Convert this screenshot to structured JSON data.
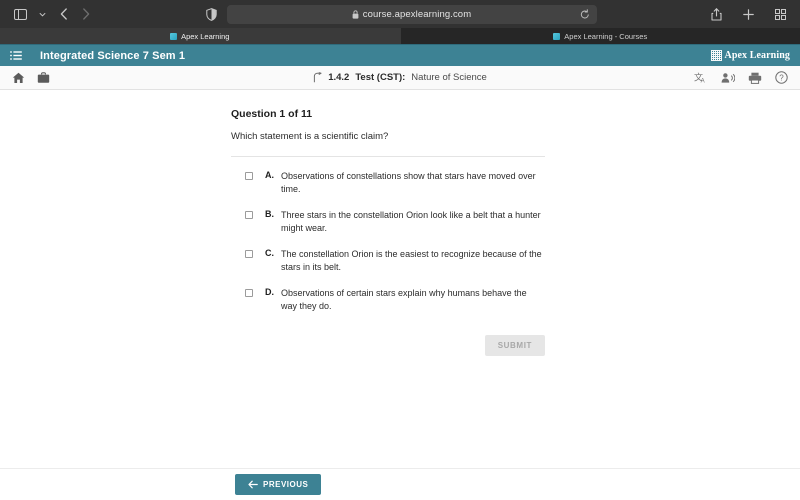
{
  "browser": {
    "sidebar_toggle": "sidebar-toggle",
    "back": "back",
    "forward": "forward",
    "privacy_report": "privacy-report",
    "url": "course.apexlearning.com",
    "reload": "reload",
    "share": "share",
    "new_tab": "new-tab",
    "tab_overview": "tab-overview",
    "tabs": [
      {
        "title": "Apex Learning",
        "active": true
      },
      {
        "title": "Apex Learning - Courses",
        "active": false
      }
    ]
  },
  "app_header": {
    "course_title": "Integrated Science 7 Sem 1",
    "brand": "Apex Learning",
    "accent_color": "#3d8294"
  },
  "sub_toolbar": {
    "home_label": "Home",
    "briefcase_label": "My Work",
    "breadcrumb": {
      "number": "1.4.2",
      "type": "Test (CST):",
      "name": "Nature of Science"
    },
    "tools": [
      "translate",
      "read-aloud",
      "print",
      "help"
    ]
  },
  "question": {
    "counter": "Question 1 of 11",
    "prompt": "Which statement is a scientific claim?",
    "options": [
      {
        "letter": "A.",
        "text": "Observations of constellations show that stars have moved over time.",
        "checked": false
      },
      {
        "letter": "B.",
        "text": "Three stars in the constellation Orion look like a belt that a hunter might wear.",
        "checked": false
      },
      {
        "letter": "C.",
        "text": "The constellation Orion is the easiest to recognize because of the stars in its belt.",
        "checked": false
      },
      {
        "letter": "D.",
        "text": "Observations of certain stars explain why humans behave the way they do.",
        "checked": false
      }
    ],
    "submit_label": "SUBMIT"
  },
  "footer": {
    "previous_label": "PREVIOUS"
  }
}
